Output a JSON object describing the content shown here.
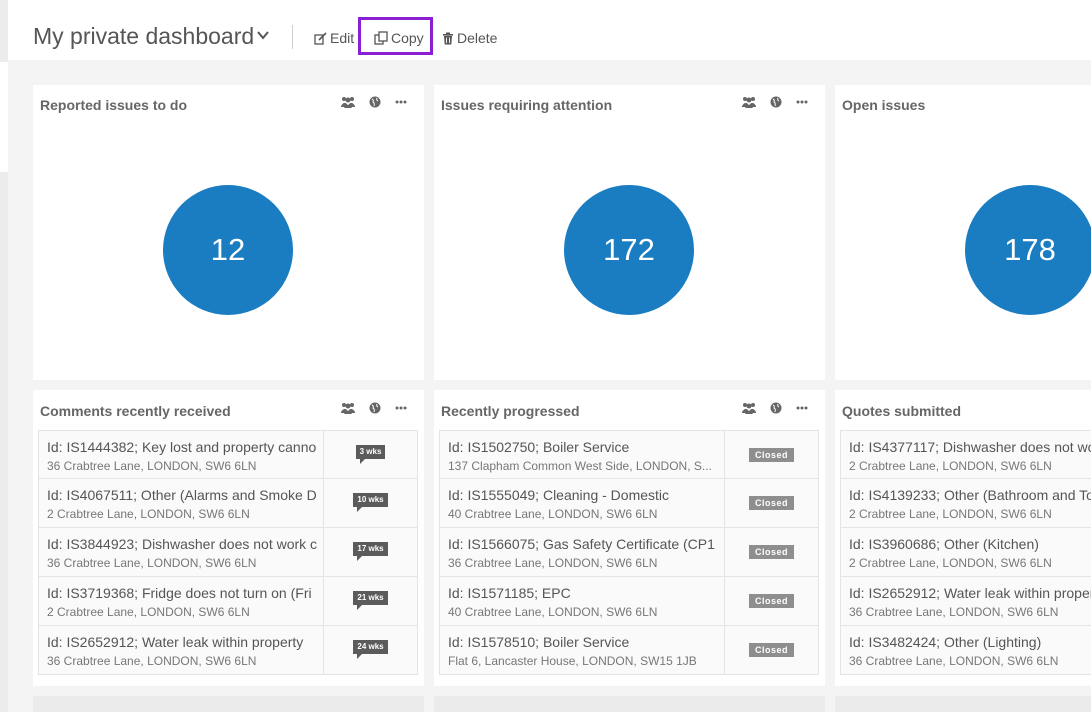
{
  "header": {
    "title": "My private dashboard",
    "edit_label": "Edit",
    "copy_label": "Copy",
    "delete_label": "Delete"
  },
  "colors": {
    "accent_circle": "#1a7dc2",
    "highlight_box": "#8b1fd6",
    "status_tag": "#8e8e8e",
    "age_bubble": "#5b5b5b"
  },
  "icons": [
    "chevron-down-icon",
    "edit-icon",
    "copy-icon",
    "trash-icon",
    "group-icon",
    "globe-icon",
    "more-icon"
  ],
  "widgets": [
    {
      "title": "Reported issues to do",
      "value": "12"
    },
    {
      "title": "Issues requiring attention",
      "value": "172"
    },
    {
      "title": "Open issues",
      "value": "178"
    },
    {
      "title": "Comments recently received",
      "rows": [
        {
          "line1": "Id: IS1444382; Key lost and property canno",
          "line2": "36 Crabtree Lane, LONDON, SW6 6LN",
          "badge": "3 wks"
        },
        {
          "line1": "Id: IS4067511; Other (Alarms and Smoke D",
          "line2": "2 Crabtree Lane, LONDON, SW6 6LN",
          "badge": "10 wks"
        },
        {
          "line1": "Id: IS3844923; Dishwasher does not work c",
          "line2": "36 Crabtree Lane, LONDON, SW6 6LN",
          "badge": "17 wks"
        },
        {
          "line1": "Id: IS3719368; Fridge does not turn on (Fri",
          "line2": "2 Crabtree Lane, LONDON, SW6 6LN",
          "badge": "21 wks"
        },
        {
          "line1": "Id: IS2652912; Water leak within property",
          "line2": "36 Crabtree Lane, LONDON, SW6 6LN",
          "badge": "24 wks"
        }
      ]
    },
    {
      "title": "Recently progressed",
      "rows": [
        {
          "line1": "Id: IS1502750; Boiler Service",
          "line2": "137 Clapham Common West Side, LONDON, S...",
          "badge": "Closed"
        },
        {
          "line1": "Id: IS1555049; Cleaning - Domestic",
          "line2": "40 Crabtree Lane, LONDON, SW6 6LN",
          "badge": "Closed"
        },
        {
          "line1": "Id: IS1566075; Gas Safety Certificate (CP1",
          "line2": "36 Crabtree Lane, LONDON, SW6 6LN",
          "badge": "Closed"
        },
        {
          "line1": "Id: IS1571185; EPC",
          "line2": "40 Crabtree Lane, LONDON, SW6 6LN",
          "badge": "Closed"
        },
        {
          "line1": "Id: IS1578510; Boiler Service",
          "line2": "Flat 6, Lancaster House, LONDON, SW15 1JB",
          "badge": "Closed"
        }
      ]
    },
    {
      "title": "Quotes submitted",
      "rows": [
        {
          "line1": "Id: IS4377117; Dishwasher does not wo",
          "line2": "2 Crabtree Lane, LONDON, SW6 6LN"
        },
        {
          "line1": "Id: IS4139233; Other (Bathroom and To",
          "line2": "2 Crabtree Lane, LONDON, SW6 6LN"
        },
        {
          "line1": "Id: IS3960686; Other (Kitchen)",
          "line2": "2 Crabtree Lane, LONDON, SW6 6LN"
        },
        {
          "line1": "Id: IS2652912; Water leak within proper",
          "line2": "36 Crabtree Lane, LONDON, SW6 6LN"
        },
        {
          "line1": "Id: IS3482424; Other (Lighting)",
          "line2": "36 Crabtree Lane, LONDON, SW6 6LN"
        }
      ]
    }
  ]
}
